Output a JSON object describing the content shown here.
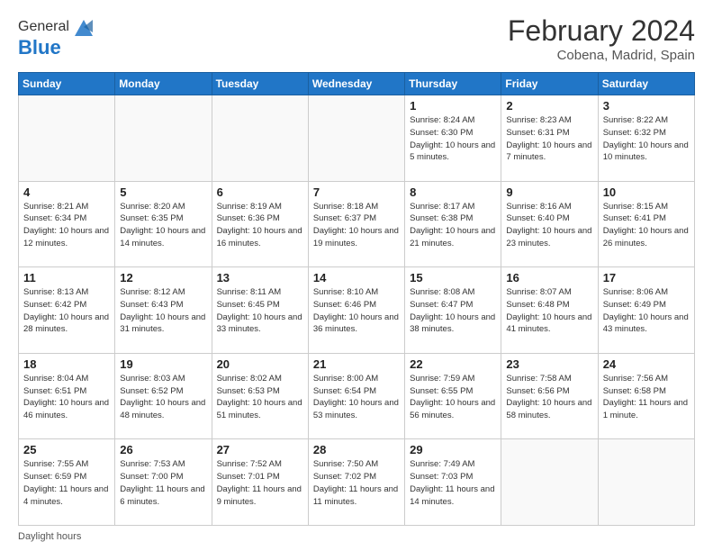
{
  "header": {
    "logo_line1": "General",
    "logo_line2": "Blue",
    "title": "February 2024",
    "location": "Cobena, Madrid, Spain"
  },
  "days_of_week": [
    "Sunday",
    "Monday",
    "Tuesday",
    "Wednesday",
    "Thursday",
    "Friday",
    "Saturday"
  ],
  "weeks": [
    [
      {
        "num": "",
        "info": ""
      },
      {
        "num": "",
        "info": ""
      },
      {
        "num": "",
        "info": ""
      },
      {
        "num": "",
        "info": ""
      },
      {
        "num": "1",
        "info": "Sunrise: 8:24 AM\nSunset: 6:30 PM\nDaylight: 10 hours\nand 5 minutes."
      },
      {
        "num": "2",
        "info": "Sunrise: 8:23 AM\nSunset: 6:31 PM\nDaylight: 10 hours\nand 7 minutes."
      },
      {
        "num": "3",
        "info": "Sunrise: 8:22 AM\nSunset: 6:32 PM\nDaylight: 10 hours\nand 10 minutes."
      }
    ],
    [
      {
        "num": "4",
        "info": "Sunrise: 8:21 AM\nSunset: 6:34 PM\nDaylight: 10 hours\nand 12 minutes."
      },
      {
        "num": "5",
        "info": "Sunrise: 8:20 AM\nSunset: 6:35 PM\nDaylight: 10 hours\nand 14 minutes."
      },
      {
        "num": "6",
        "info": "Sunrise: 8:19 AM\nSunset: 6:36 PM\nDaylight: 10 hours\nand 16 minutes."
      },
      {
        "num": "7",
        "info": "Sunrise: 8:18 AM\nSunset: 6:37 PM\nDaylight: 10 hours\nand 19 minutes."
      },
      {
        "num": "8",
        "info": "Sunrise: 8:17 AM\nSunset: 6:38 PM\nDaylight: 10 hours\nand 21 minutes."
      },
      {
        "num": "9",
        "info": "Sunrise: 8:16 AM\nSunset: 6:40 PM\nDaylight: 10 hours\nand 23 minutes."
      },
      {
        "num": "10",
        "info": "Sunrise: 8:15 AM\nSunset: 6:41 PM\nDaylight: 10 hours\nand 26 minutes."
      }
    ],
    [
      {
        "num": "11",
        "info": "Sunrise: 8:13 AM\nSunset: 6:42 PM\nDaylight: 10 hours\nand 28 minutes."
      },
      {
        "num": "12",
        "info": "Sunrise: 8:12 AM\nSunset: 6:43 PM\nDaylight: 10 hours\nand 31 minutes."
      },
      {
        "num": "13",
        "info": "Sunrise: 8:11 AM\nSunset: 6:45 PM\nDaylight: 10 hours\nand 33 minutes."
      },
      {
        "num": "14",
        "info": "Sunrise: 8:10 AM\nSunset: 6:46 PM\nDaylight: 10 hours\nand 36 minutes."
      },
      {
        "num": "15",
        "info": "Sunrise: 8:08 AM\nSunset: 6:47 PM\nDaylight: 10 hours\nand 38 minutes."
      },
      {
        "num": "16",
        "info": "Sunrise: 8:07 AM\nSunset: 6:48 PM\nDaylight: 10 hours\nand 41 minutes."
      },
      {
        "num": "17",
        "info": "Sunrise: 8:06 AM\nSunset: 6:49 PM\nDaylight: 10 hours\nand 43 minutes."
      }
    ],
    [
      {
        "num": "18",
        "info": "Sunrise: 8:04 AM\nSunset: 6:51 PM\nDaylight: 10 hours\nand 46 minutes."
      },
      {
        "num": "19",
        "info": "Sunrise: 8:03 AM\nSunset: 6:52 PM\nDaylight: 10 hours\nand 48 minutes."
      },
      {
        "num": "20",
        "info": "Sunrise: 8:02 AM\nSunset: 6:53 PM\nDaylight: 10 hours\nand 51 minutes."
      },
      {
        "num": "21",
        "info": "Sunrise: 8:00 AM\nSunset: 6:54 PM\nDaylight: 10 hours\nand 53 minutes."
      },
      {
        "num": "22",
        "info": "Sunrise: 7:59 AM\nSunset: 6:55 PM\nDaylight: 10 hours\nand 56 minutes."
      },
      {
        "num": "23",
        "info": "Sunrise: 7:58 AM\nSunset: 6:56 PM\nDaylight: 10 hours\nand 58 minutes."
      },
      {
        "num": "24",
        "info": "Sunrise: 7:56 AM\nSunset: 6:58 PM\nDaylight: 11 hours\nand 1 minute."
      }
    ],
    [
      {
        "num": "25",
        "info": "Sunrise: 7:55 AM\nSunset: 6:59 PM\nDaylight: 11 hours\nand 4 minutes."
      },
      {
        "num": "26",
        "info": "Sunrise: 7:53 AM\nSunset: 7:00 PM\nDaylight: 11 hours\nand 6 minutes."
      },
      {
        "num": "27",
        "info": "Sunrise: 7:52 AM\nSunset: 7:01 PM\nDaylight: 11 hours\nand 9 minutes."
      },
      {
        "num": "28",
        "info": "Sunrise: 7:50 AM\nSunset: 7:02 PM\nDaylight: 11 hours\nand 11 minutes."
      },
      {
        "num": "29",
        "info": "Sunrise: 7:49 AM\nSunset: 7:03 PM\nDaylight: 11 hours\nand 14 minutes."
      },
      {
        "num": "",
        "info": ""
      },
      {
        "num": "",
        "info": ""
      }
    ]
  ],
  "footer": "Daylight hours"
}
